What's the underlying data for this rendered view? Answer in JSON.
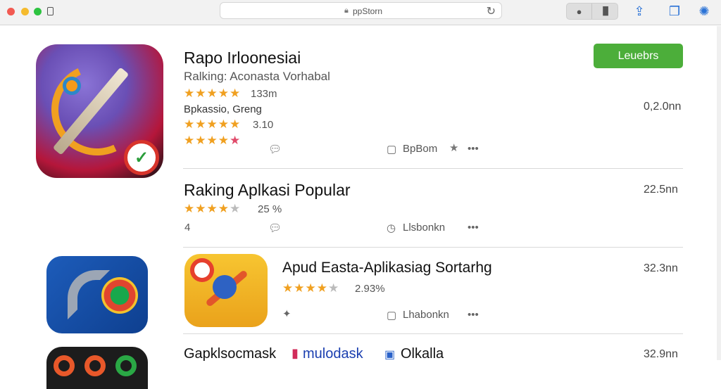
{
  "toolbar": {
    "address_text": "ppStorn",
    "lock_icon": "lock-icon",
    "reload_icon": "reload-icon"
  },
  "apps": [
    {
      "title": "Rapo Irloonesiai",
      "subtitle": "Ralking: Aconasta Vorhabal",
      "rating_count": "133m",
      "category": "Bpkassio, Greng",
      "rating_value": "3.10",
      "get_label": "Leuebrs",
      "size": "0,2.0nn",
      "seller": "BpBom"
    },
    {
      "title": "Raking Aplkasi Popular",
      "rating_value": "25 %",
      "size": "22.5nn",
      "rank": "4",
      "seller": "Llsbonkn"
    },
    {
      "title": "Apud Easta-Aplikasiag Sortarhg",
      "rating_value": "2.93%",
      "size": "32.3nn",
      "seller": "Lhabonkn"
    },
    {
      "title": "Gapklsocmask",
      "title_part2": "mulodask",
      "title_part3": "Olkalla",
      "size": "32.9nn"
    }
  ]
}
